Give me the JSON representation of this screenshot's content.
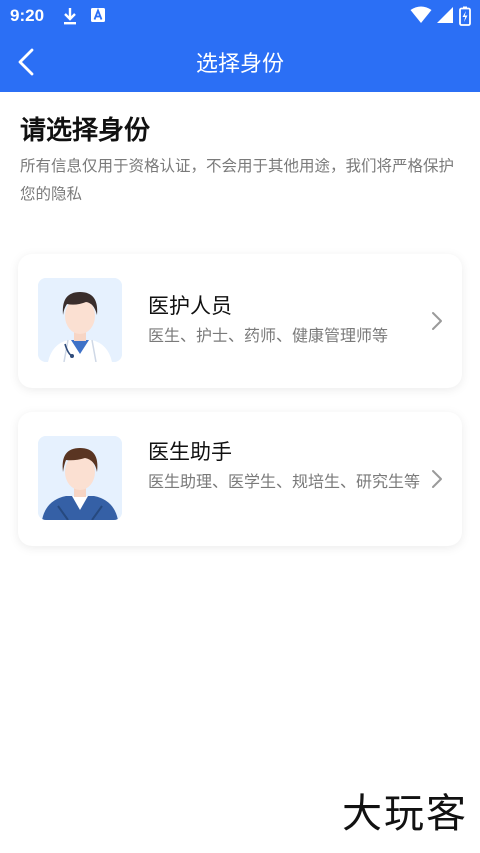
{
  "status_bar": {
    "time": "9:20",
    "icons": [
      "download-icon",
      "a-app-icon",
      "wifi-icon",
      "cell-signal-icon",
      "battery-charging-icon"
    ]
  },
  "app_bar": {
    "back_icon": "chevron-left-icon",
    "title": "选择身份"
  },
  "main": {
    "heading": "请选择身份",
    "description": "所有信息仅用于资格认证，不会用于其他用途，我们将严格保护您的隐私"
  },
  "identity_options": [
    {
      "title": "医护人员",
      "subtitle": "医生、护士、药师、健康管理师等",
      "avatar_icon": "doctor-avatar-icon"
    },
    {
      "title": "医生助手",
      "subtitle": "医生助理、医学生、规培生、研究生等",
      "avatar_icon": "assistant-avatar-icon"
    }
  ],
  "watermark": "大玩客",
  "colors": {
    "primary": "#2b6ff5",
    "text_primary": "#111111",
    "text_secondary": "#7a7a7a",
    "avatar_bg": "#e6f1fe"
  }
}
